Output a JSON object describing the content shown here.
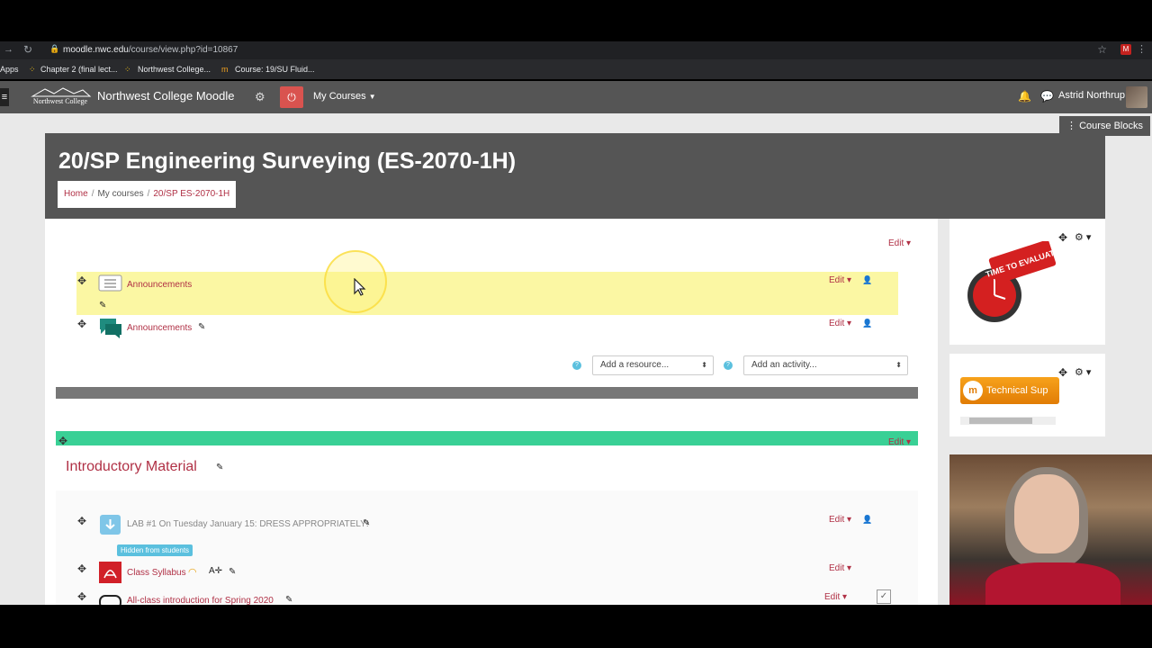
{
  "browser": {
    "url_host": "moodle.nwc.edu",
    "url_path": "/course/view.php?id=10867",
    "bookmarks": [
      "Apps",
      "Chapter 2 (final lect...",
      "Northwest College...",
      "Course: 19/SU Fluid..."
    ]
  },
  "navbar": {
    "logo_text": "Northwest College",
    "site_name": "Northwest College Moodle",
    "my_courses": "My Courses",
    "user_name": "Astrid Northrup"
  },
  "course": {
    "title": "20/SP Engineering Surveying (ES-2070-1H)",
    "breadcrumb": [
      "Home",
      "My courses",
      "20/SP ES-2070-1H"
    ],
    "course_blocks_label": "Course Blocks"
  },
  "section0": {
    "edit_label": "Edit",
    "items": [
      {
        "label": "Announcements",
        "edit": "Edit"
      },
      {
        "label": "Announcements",
        "edit": "Edit"
      }
    ],
    "add_resource": "Add a resource...",
    "add_activity": "Add an activity..."
  },
  "section1": {
    "title": "Introductory Material",
    "edit_label": "Edit",
    "items": [
      {
        "label": "LAB #1 On Tuesday January 15: DRESS APPROPRIATELY!",
        "edit": "Edit",
        "badge": "Hidden from students"
      },
      {
        "label": "Class Syllabus",
        "edit": "Edit"
      },
      {
        "label": "All-class introduction for Spring 2020",
        "edit": "Edit"
      }
    ]
  },
  "blocks": {
    "evaluate_text": "TIME TO EVALUATE",
    "tech_support": "Technical Sup"
  },
  "colors": {
    "accent": "#b03045",
    "navbar": "#555555",
    "highlight": "#fbf7a3",
    "green_band": "#39d095"
  }
}
